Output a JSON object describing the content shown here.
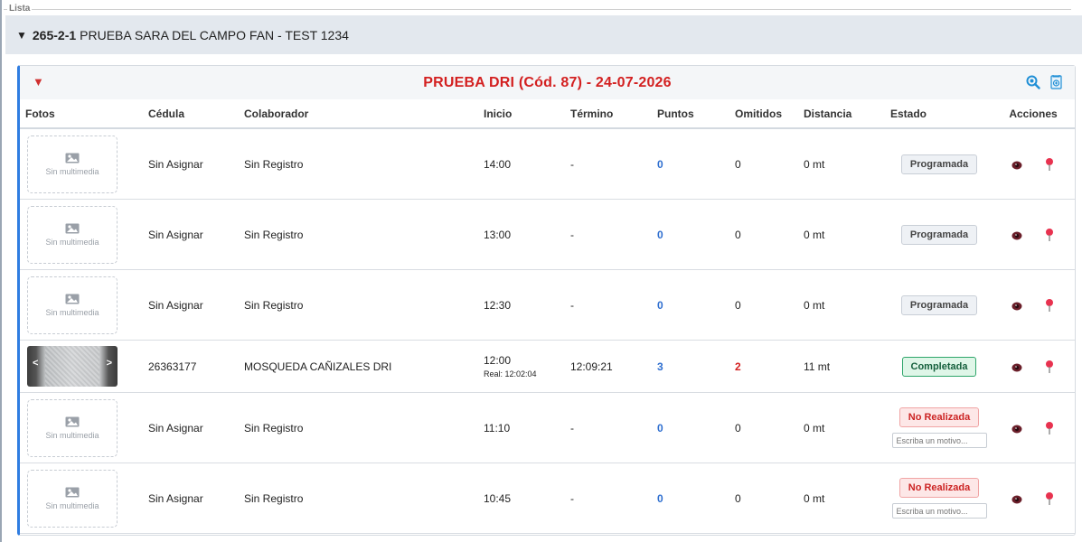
{
  "fieldset": {
    "legend": "Lista"
  },
  "group": {
    "code": "265-2-1",
    "name": "PRUEBA SARA DEL CAMPO FAN - TEST 1234"
  },
  "panel": {
    "title": "PRUEBA DRI (Cód. 87) - 24-07-2026"
  },
  "columns": {
    "fotos": "Fotos",
    "cedula": "Cédula",
    "colaborador": "Colaborador",
    "inicio": "Inicio",
    "termino": "Término",
    "puntos": "Puntos",
    "omitidos": "Omitidos",
    "distancia": "Distancia",
    "estado": "Estado",
    "acciones": "Acciones"
  },
  "media": {
    "empty_label": "Sin multimedia",
    "prev": "<",
    "next": ">"
  },
  "rows": [
    {
      "cedula": "Sin Asignar",
      "colaborador": "Sin Registro",
      "inicio": "14:00",
      "real": "",
      "termino": "-",
      "puntos": "0",
      "omitidos": "0",
      "distancia": "0 mt",
      "estado": "Programada",
      "motivo_placeholder": ""
    },
    {
      "cedula": "Sin Asignar",
      "colaborador": "Sin Registro",
      "inicio": "13:00",
      "real": "",
      "termino": "-",
      "puntos": "0",
      "omitidos": "0",
      "distancia": "0 mt",
      "estado": "Programada",
      "motivo_placeholder": ""
    },
    {
      "cedula": "Sin Asignar",
      "colaborador": "Sin Registro",
      "inicio": "12:30",
      "real": "",
      "termino": "-",
      "puntos": "0",
      "omitidos": "0",
      "distancia": "0 mt",
      "estado": "Programada",
      "motivo_placeholder": ""
    },
    {
      "cedula": "26363177",
      "colaborador": "MOSQUEDA CAÑIZALES DRI",
      "inicio": "12:00",
      "real": "Real: 12:02:04",
      "termino": "12:09:21",
      "puntos": "3",
      "omitidos": "2",
      "distancia": "11 mt",
      "estado": "Completada",
      "motivo_placeholder": ""
    },
    {
      "cedula": "Sin Asignar",
      "colaborador": "Sin Registro",
      "inicio": "11:10",
      "real": "",
      "termino": "-",
      "puntos": "0",
      "omitidos": "0",
      "distancia": "0 mt",
      "estado": "No Realizada",
      "motivo_placeholder": "Escriba un motivo..."
    },
    {
      "cedula": "Sin Asignar",
      "colaborador": "Sin Registro",
      "inicio": "10:45",
      "real": "",
      "termino": "-",
      "puntos": "0",
      "omitidos": "0",
      "distancia": "0 mt",
      "estado": "No Realizada",
      "motivo_placeholder": "Escriba un motivo..."
    }
  ],
  "colors": {
    "accent_blue": "#2f7de1",
    "title_red": "#d32020",
    "completed_green": "#2ea56a"
  }
}
